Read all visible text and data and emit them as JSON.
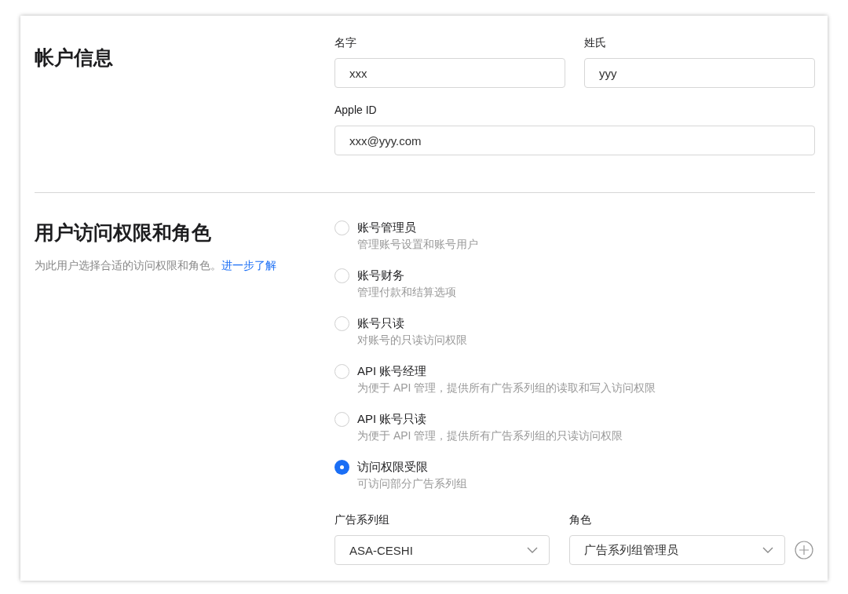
{
  "account": {
    "title": "帐户信息",
    "first_name": {
      "label": "名字",
      "value": "xxx"
    },
    "last_name": {
      "label": "姓氏",
      "value": "yyy"
    },
    "apple_id": {
      "label": "Apple ID",
      "value": "xxx@yyy.com"
    }
  },
  "access": {
    "title": "用户访问权限和角色",
    "description": "为此用户选择合适的访问权限和角色。",
    "link": "进一步了解",
    "roles": [
      {
        "label": "账号管理员",
        "description": "管理账号设置和账号用户",
        "selected": false
      },
      {
        "label": "账号财务",
        "description": "管理付款和结算选项",
        "selected": false
      },
      {
        "label": "账号只读",
        "description": "对账号的只读访问权限",
        "selected": false
      },
      {
        "label": "API 账号经理",
        "description": "为便于 API 管理，提供所有广告系列组的读取和写入访问权限",
        "selected": false
      },
      {
        "label": "API 账号只读",
        "description": "为便于 API 管理，提供所有广告系列组的只读访问权限",
        "selected": false
      },
      {
        "label": "访问权限受限",
        "description": "可访问部分广告系列组",
        "selected": true
      }
    ],
    "campaign_group": {
      "label": "广告系列组",
      "value": "ASA-CESHI"
    },
    "role": {
      "label": "角色",
      "value": "广告系列组管理员"
    }
  }
}
